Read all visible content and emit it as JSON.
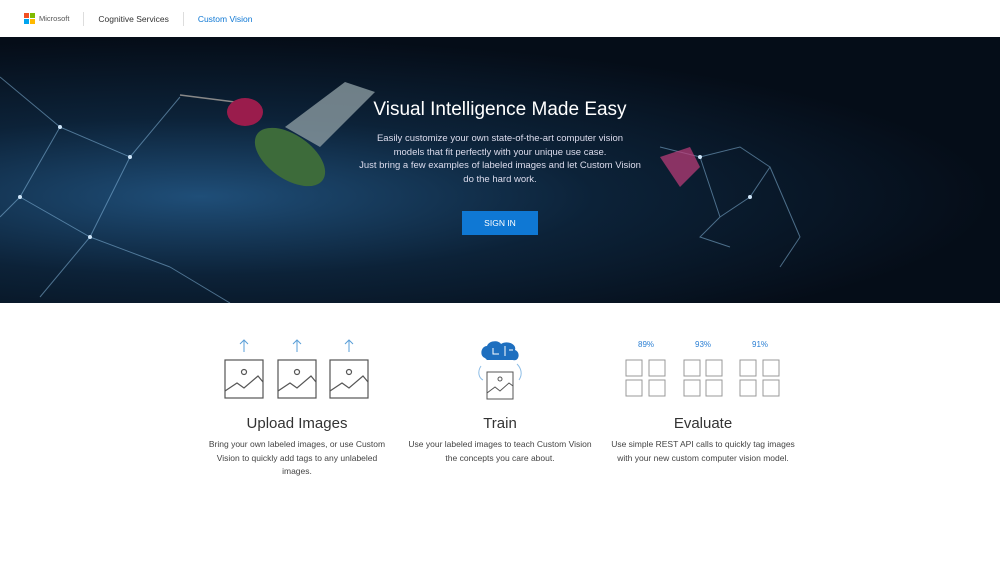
{
  "nav": {
    "brand": "Microsoft",
    "items": [
      "Cognitive Services",
      "Custom Vision"
    ],
    "active_color": "#0f78d4"
  },
  "hero": {
    "title": "Visual Intelligence Made Easy",
    "subtitle_lines": [
      "Easily customize your own state-of-the-art computer vision",
      "models that fit perfectly with your unique use case.",
      "Just bring a few examples of labeled images and let Custom Vision",
      "do the hard work."
    ],
    "signin_label": "SIGN IN"
  },
  "features": [
    {
      "title": "Upload Images",
      "desc": "Bring your own labeled images, or use Custom Vision to quickly add tags to any unlabeled images.",
      "icon": "upload-images-icon"
    },
    {
      "title": "Train",
      "desc": "Use your labeled images to teach Custom Vision the concepts you care about.",
      "icon": "brain-train-icon"
    },
    {
      "title": "Evaluate",
      "desc": "Use simple REST API calls to quickly tag images with your new custom computer vision model.",
      "icon": "evaluate-grid-icon",
      "scores": [
        "89%",
        "93%",
        "91%"
      ]
    }
  ]
}
